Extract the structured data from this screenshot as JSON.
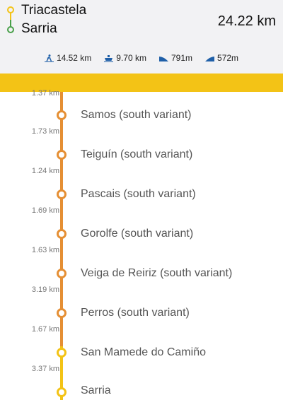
{
  "header": {
    "from": "Triacastela",
    "to": "Sarria",
    "total_distance": "24.22 km",
    "stats": [
      {
        "icon": "walking-flat-icon",
        "value": "14.52 km"
      },
      {
        "icon": "ferry-icon",
        "value": "9.70 km"
      },
      {
        "icon": "elevation-down-icon",
        "value": "791m"
      },
      {
        "icon": "elevation-up-icon",
        "value": "572m"
      }
    ]
  },
  "colors": {
    "orange": "#e58f34",
    "yellow": "#f3c316",
    "green": "#49a04a",
    "banner": "#f3c316"
  },
  "timeline": {
    "top_distance": "1.37 km",
    "stops": [
      {
        "name": "Samos (south variant)",
        "distance_after": "1.73 km"
      },
      {
        "name": "Teiguín (south variant)",
        "distance_after": "1.24 km"
      },
      {
        "name": "Pascais (south variant)",
        "distance_after": "1.69 km"
      },
      {
        "name": "Gorolfe (south variant)",
        "distance_after": "1.63 km"
      },
      {
        "name": "Veiga de Reiriz (south variant)",
        "distance_after": "3.19 km"
      },
      {
        "name": "Perros (south variant)",
        "distance_after": "1.67 km"
      },
      {
        "name": "San Mamede do Camiño",
        "distance_after": "3.37 km"
      },
      {
        "name": "Sarria",
        "distance_after": ""
      }
    ]
  }
}
